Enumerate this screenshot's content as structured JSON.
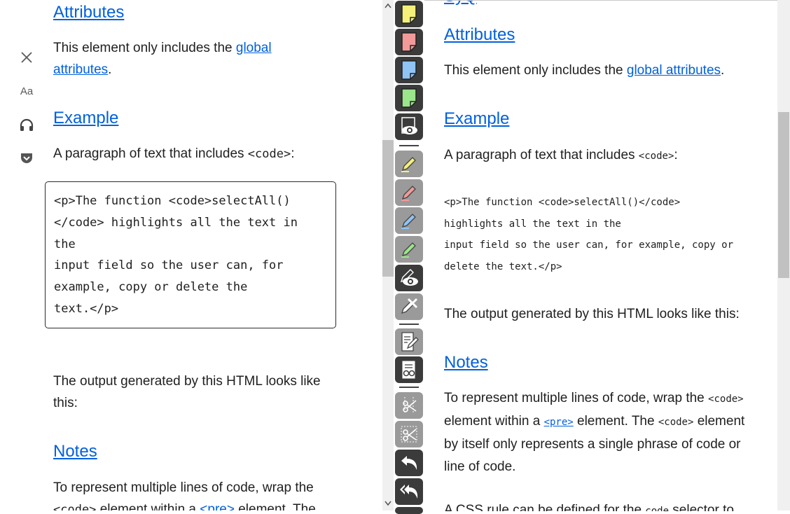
{
  "reader": {
    "tools": [
      "close-icon",
      "text-size-icon",
      "headphones-icon",
      "pocket-icon"
    ],
    "text_size_label": "Aa",
    "attributes_heading": "Attributes",
    "attributes_text_before": "This element only includes the ",
    "attributes_link_part1": "global",
    "attributes_link_part2": "attributes",
    "attributes_text_after": ".",
    "example_heading": "Example",
    "example_text": "A paragraph of text that includes ",
    "example_code": "<code>",
    "example_colon": ":",
    "code_block": "<p>The function <code>selectAll()\n</code> highlights all the text in\nthe\ninput field so the user can, for\nexample, copy or delete the\ntext.</p>",
    "output_text_line1": "The output generated by this HTML looks like",
    "output_text_line2": "this:",
    "notes_heading": "Notes",
    "notes_text": "To represent multiple lines of code, wrap the",
    "notes_text_cut_1": "<code>",
    "notes_text_cut_2": " element within a ",
    "notes_text_cut_3": "<pre>",
    "notes_text_cut_4": " element. The"
  },
  "toolbar": {
    "buttons": [
      "yellow-note-icon",
      "red-note-icon",
      "blue-note-icon",
      "green-note-icon",
      "show-notes-eye-icon",
      "yellow-highlighter-icon",
      "red-highlighter-icon",
      "blue-highlighter-icon",
      "green-highlighter-icon",
      "show-highlights-eye-icon",
      "erase-highlights-icon",
      "edit-page-icon",
      "view-page-icon",
      "scissors-icon",
      "scissors-alt-icon",
      "undo-icon",
      "undo-all-icon"
    ],
    "colors": {
      "yellow": "#f4f07a",
      "red": "#f29a9a",
      "blue": "#8fc4f5",
      "green": "#9be58a"
    }
  },
  "doc": {
    "top_cut_text": "SyQ",
    "attributes_heading": "Attributes",
    "attributes_text_before": "This element only includes the ",
    "attributes_link": "global attributes",
    "attributes_text_after": ".",
    "example_heading": "Example",
    "example_text": "A paragraph of text that includes ",
    "example_code": "<code>",
    "example_colon": ":",
    "pre_lines": [
      "<p>The function <code>selectAll()</code>",
      "highlights all the text in the",
      "input field so the user can, for example, copy or",
      "delete the text.</p>"
    ],
    "output_text": "The output generated by this HTML looks like this:",
    "notes_heading": "Notes",
    "notes_l1_a": "To represent multiple lines of code, wrap the ",
    "notes_l1_code": "<code>",
    "notes_l2_a": "element within a ",
    "notes_l2_link": "<pre>",
    "notes_l2_b": " element. The ",
    "notes_l2_code": "<code>",
    "notes_l2_c": " element",
    "notes_l3": "by itself only represents a single phrase of code or",
    "notes_l4": "line of code.",
    "bottom_cut_a": "A CSS rule can be defined for the ",
    "bottom_cut_code": "code",
    "bottom_cut_b": " selector to"
  }
}
